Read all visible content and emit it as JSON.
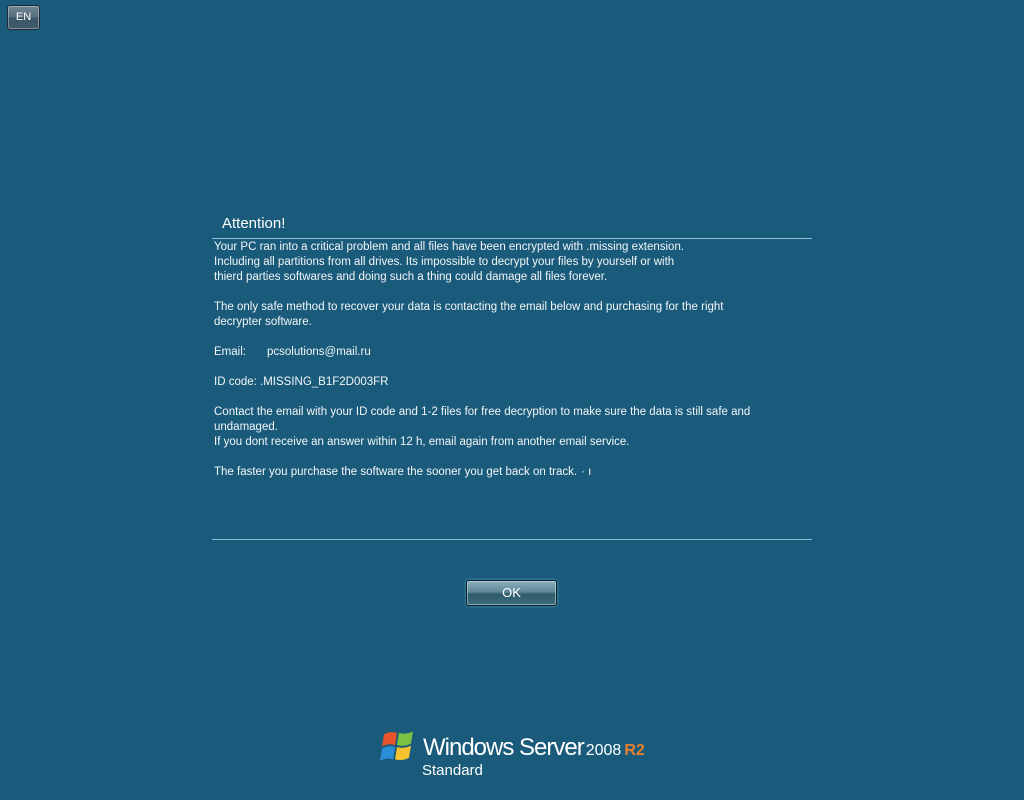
{
  "language_button": {
    "label": "EN"
  },
  "dialog": {
    "title": "Attention!",
    "lines": {
      "l1": "Your PC ran into a critical problem and all files have been encrypted with .missing extension.",
      "l2": "Including all partitions from all drives. Its impossible to decrypt your files by yourself or with",
      "l3": "thierd parties softwares and doing such a thing could damage all files forever.",
      "l4": "The only safe method to recover your data is contacting the email below and purchasing for the right",
      "l5": "decrypter software.",
      "email_label": "Email:",
      "email_value": "pcsolutions@mail.ru",
      "id_line": "ID code: .MISSING_B1F2D003FR",
      "l6": "Contact the email with your ID code and 1-2 files for free decryption to make sure the data is still safe and",
      "l7": "undamaged.",
      "l8": "If you dont receive an answer within 12 h, email again from another email service.",
      "l9": "The faster you purchase the software the sooner you get back on track.",
      "cursor": "· ı"
    },
    "ok_label": "OK"
  },
  "branding": {
    "name": "Windows Server",
    "version": "2008",
    "release": "R2",
    "edition": "Standard",
    "logo_icon": "windows-flag-icon",
    "colors": {
      "background": "#1a5b7b",
      "flag_red": "#e8542a",
      "flag_green": "#7cc242",
      "flag_blue": "#2d8ed8",
      "flag_yellow": "#f5c12e",
      "r2": "#e8802c"
    }
  }
}
